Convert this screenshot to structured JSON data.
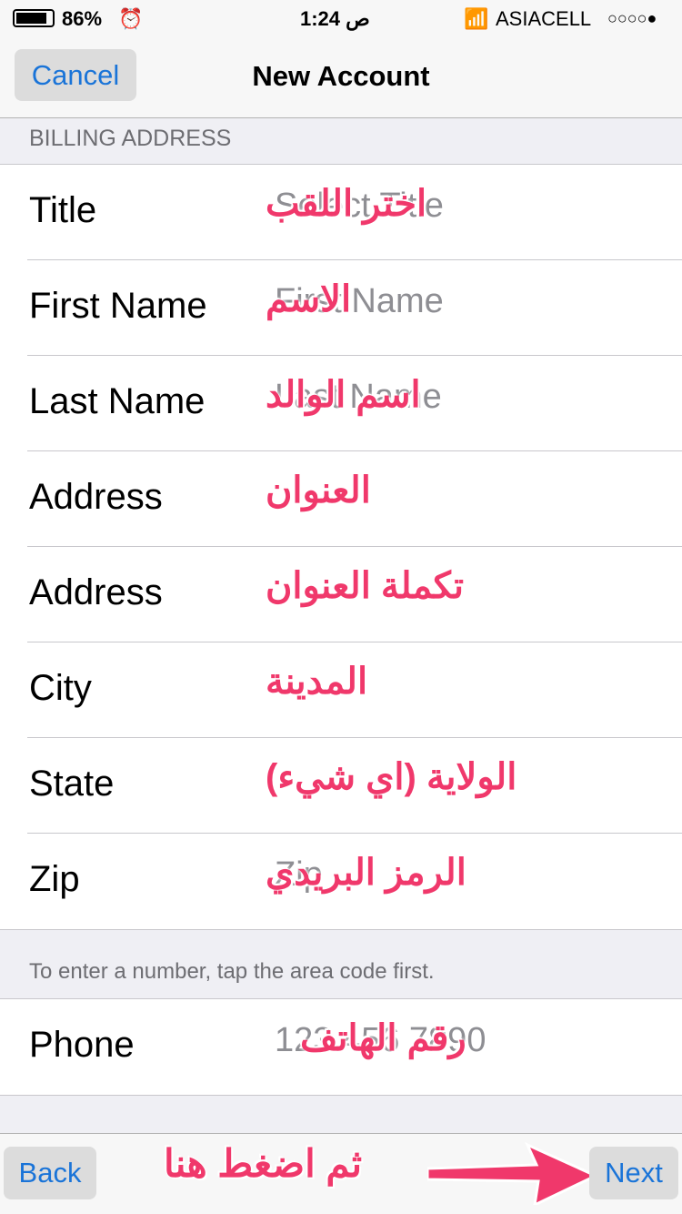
{
  "status": {
    "battery": "86%",
    "time": "1:24 ص",
    "carrier": "ASIACELL",
    "signal": "○○○○●"
  },
  "nav": {
    "cancel": "Cancel",
    "title": "New Account"
  },
  "section": "BILLING ADDRESS",
  "rows": [
    {
      "label": "Title",
      "placeholder": "Select Title",
      "annotation": "اختر اللقب"
    },
    {
      "label": "First Name",
      "placeholder": "First Name",
      "annotation": "الاسم"
    },
    {
      "label": "Last Name",
      "placeholder": "Last Name",
      "annotation": "اسم الوالد"
    },
    {
      "label": "Address",
      "placeholder": "",
      "annotation": "العنوان"
    },
    {
      "label": "Address",
      "placeholder": "",
      "annotation": "تكملة العنوان"
    },
    {
      "label": "City",
      "placeholder": "",
      "annotation": "المدينة"
    },
    {
      "label": "State",
      "placeholder": "",
      "annotation": "الولاية (اي شيء)"
    },
    {
      "label": "Zip",
      "placeholder": "Zip",
      "annotation": "الرمز البريدي"
    }
  ],
  "note": "To enter a number, tap the area code first.",
  "phone": {
    "label": "Phone",
    "placeholder": "123 456 7890",
    "annotation": "رقم الهاتف"
  },
  "toolbar": {
    "back": "Back",
    "next": "Next",
    "hint": "ثم اضغط هنا"
  },
  "colors": {
    "accent": "#1a74d8",
    "annotation": "#f0386b"
  }
}
